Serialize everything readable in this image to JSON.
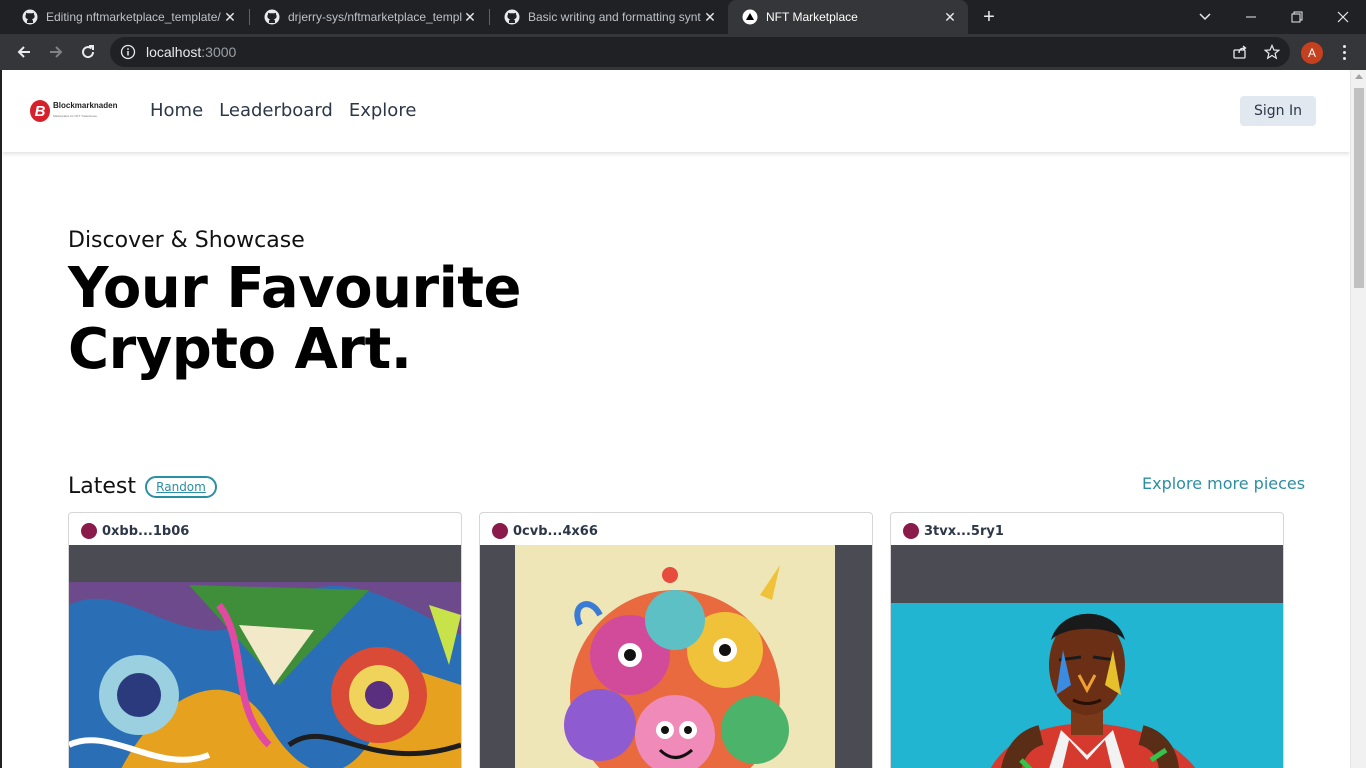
{
  "browser": {
    "tabs": [
      {
        "title": "Editing nftmarketplace_template/",
        "icon": "github-icon",
        "active": false
      },
      {
        "title": "drjerry-sys/nftmarketplace_templ",
        "icon": "github-icon",
        "active": false
      },
      {
        "title": "Basic writing and formatting synt",
        "icon": "github-icon",
        "active": false
      },
      {
        "title": "NFT Marketplace",
        "icon": "nextjs-icon",
        "active": true
      }
    ],
    "url_host": "localhost",
    "url_port": ":3000",
    "profile_initial": "A"
  },
  "site": {
    "logo_text": "Blockmarknaden",
    "logo_tagline": "Marketplace for NFT Tradehouse",
    "nav": [
      "Home",
      "Leaderboard",
      "Explore"
    ],
    "sign_in": "Sign In"
  },
  "hero": {
    "subtitle": "Discover & Showcase",
    "title_line1": "Your Favourite",
    "title_line2": "Crypto Art."
  },
  "latest": {
    "heading": "Latest",
    "filter": "Random",
    "explore_link": "Explore more pieces",
    "cards": [
      {
        "owner": "0xbb...1b06",
        "artwork": "abstract-colorful-art"
      },
      {
        "owner": "0cvb...4x66",
        "artwork": "colorful-monsters-art"
      },
      {
        "owner": "3tvx...5ry1",
        "artwork": "pop-art-basketball-player"
      }
    ]
  },
  "colors": {
    "accent": "#2b8fa3",
    "owner_dot": "#8a1a4a",
    "chrome_dark": "#202124",
    "chrome_toolbar": "#35363a"
  }
}
